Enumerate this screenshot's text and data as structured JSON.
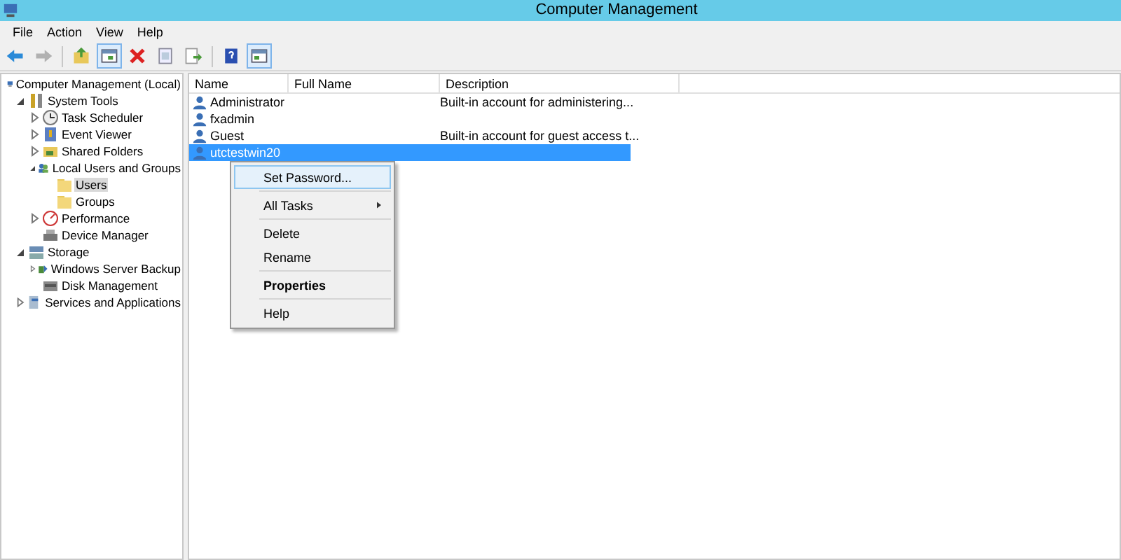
{
  "window": {
    "title": "Computer Management"
  },
  "menu_bar": [
    "File",
    "Action",
    "View",
    "Help"
  ],
  "toolbar": [
    {
      "kind": "back",
      "disabled": false,
      "pressed": false
    },
    {
      "kind": "forward",
      "disabled": true,
      "pressed": false
    },
    {
      "kind": "sep"
    },
    {
      "kind": "up",
      "disabled": false,
      "pressed": false
    },
    {
      "kind": "tree",
      "disabled": false,
      "pressed": true
    },
    {
      "kind": "delete",
      "disabled": false,
      "pressed": false
    },
    {
      "kind": "properties",
      "disabled": false,
      "pressed": false
    },
    {
      "kind": "export",
      "disabled": false,
      "pressed": false
    },
    {
      "kind": "sep"
    },
    {
      "kind": "help",
      "disabled": false,
      "pressed": false
    },
    {
      "kind": "pane",
      "disabled": false,
      "pressed": true
    }
  ],
  "tree": [
    {
      "label": "Computer Management (Local)",
      "kind": "computer",
      "selected": false,
      "children": [
        {
          "label": "System Tools",
          "kind": "tools",
          "expanded": true,
          "selected": false,
          "children": [
            {
              "label": "Task Scheduler",
              "kind": "clock",
              "expanded": false,
              "selected": false
            },
            {
              "label": "Event Viewer",
              "kind": "log",
              "expanded": false,
              "selected": false
            },
            {
              "label": "Shared Folders",
              "kind": "share",
              "expanded": false,
              "selected": false
            },
            {
              "label": "Local Users and Groups",
              "kind": "users",
              "expanded": true,
              "selected": false,
              "children": [
                {
                  "label": "Users",
                  "kind": "folder",
                  "selected": true
                },
                {
                  "label": "Groups",
                  "kind": "folder",
                  "selected": false
                }
              ]
            },
            {
              "label": "Performance",
              "kind": "gauge",
              "expanded": false,
              "selected": false
            },
            {
              "label": "Device Manager",
              "kind": "device",
              "selected": false
            }
          ]
        },
        {
          "label": "Storage",
          "kind": "storage",
          "expanded": true,
          "selected": false,
          "children": [
            {
              "label": "Windows Server Backup",
              "kind": "backup",
              "expanded": false,
              "selected": false
            },
            {
              "label": "Disk Management",
              "kind": "disk",
              "selected": false
            }
          ]
        },
        {
          "label": "Services and Applications",
          "kind": "services",
          "expanded": false,
          "selected": false
        }
      ]
    }
  ],
  "table": {
    "columns": [
      "Name",
      "Full Name",
      "Description"
    ],
    "rows": [
      {
        "name": "Administrator",
        "description": "Built-in account for administering...",
        "selected": false
      },
      {
        "name": "fxadmin",
        "selected": false
      },
      {
        "name": "Guest",
        "description": "Built-in account for guest access t...",
        "selected": false
      },
      {
        "name": "utctestwin20",
        "selected": true
      }
    ]
  },
  "context_menu": {
    "groups": [
      [
        {
          "label": "Set Password...",
          "kind": "item",
          "selected": true
        }
      ],
      [
        {
          "label": "All Tasks",
          "kind": "submenu",
          "selected": false
        }
      ],
      [
        {
          "label": "Delete",
          "kind": "item",
          "selected": false
        },
        {
          "label": "Rename",
          "kind": "item",
          "selected": false
        }
      ],
      [
        {
          "label": "Properties",
          "kind": "default",
          "selected": false
        }
      ],
      [
        {
          "label": "Help",
          "kind": "item",
          "selected": false
        }
      ]
    ]
  }
}
